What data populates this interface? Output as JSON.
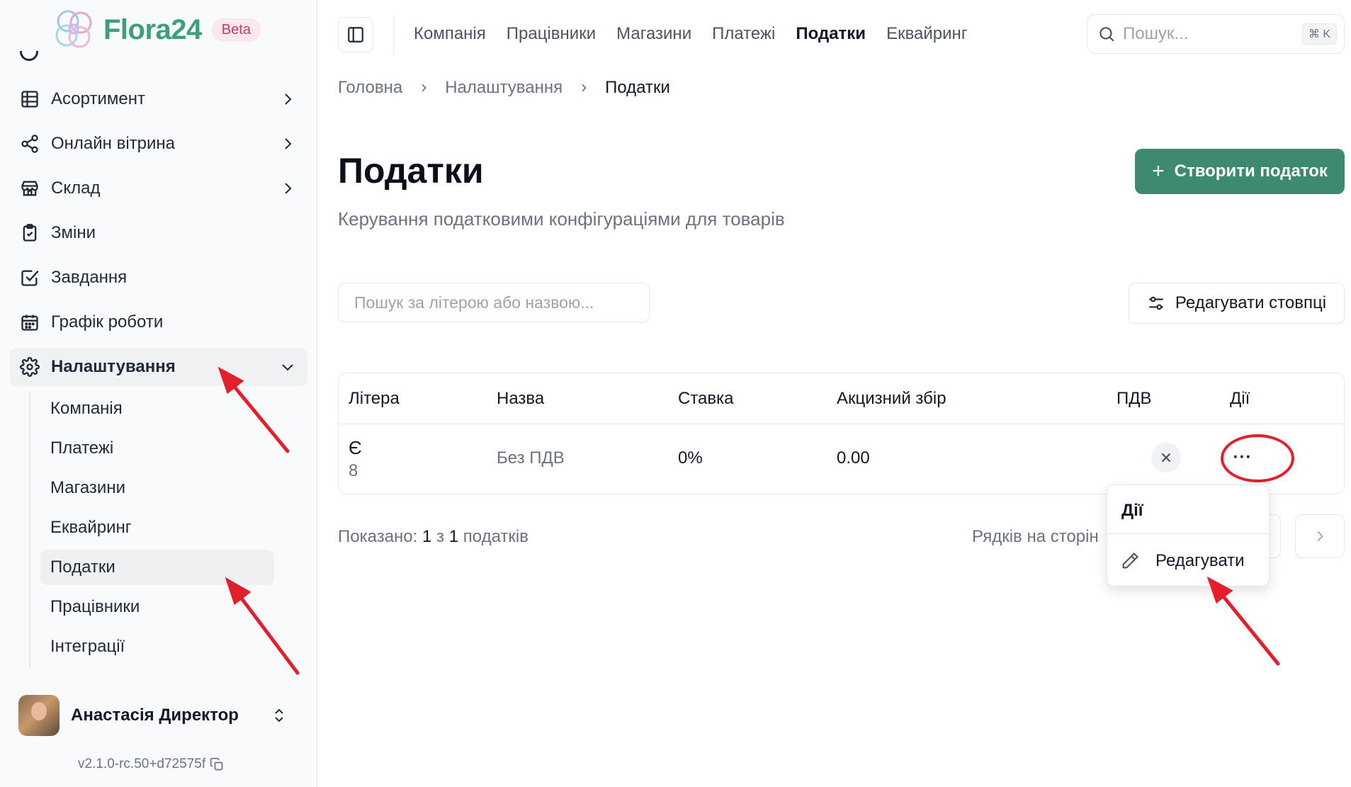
{
  "brand": {
    "name": "Flora24",
    "badge": "Beta"
  },
  "sidebar": {
    "items": [
      {
        "label": "Асортимент",
        "icon": "grid-icon",
        "has_chevron": true
      },
      {
        "label": "Онлайн вітрина",
        "icon": "share-icon",
        "has_chevron": true
      },
      {
        "label": "Склад",
        "icon": "store-icon",
        "has_chevron": true
      },
      {
        "label": "Зміни",
        "icon": "clipboard-icon",
        "has_chevron": false
      },
      {
        "label": "Завдання",
        "icon": "checkbox-icon",
        "has_chevron": false
      },
      {
        "label": "Графік роботи",
        "icon": "calendar-icon",
        "has_chevron": false
      },
      {
        "label": "Налаштування",
        "icon": "gear-icon",
        "has_chevron": true,
        "expanded": true
      }
    ],
    "subitems": [
      {
        "label": "Компанія"
      },
      {
        "label": "Платежі"
      },
      {
        "label": "Магазини"
      },
      {
        "label": "Еквайринг"
      },
      {
        "label": "Податки",
        "active": true
      },
      {
        "label": "Працівники"
      },
      {
        "label": "Інтеграції"
      }
    ],
    "user": {
      "name": "Анастасія Директор"
    },
    "version": "v2.1.0-rc.50+d72575f"
  },
  "topnav": {
    "items": [
      "Компанія",
      "Працівники",
      "Магазини",
      "Платежі",
      "Податки",
      "Еквайринг"
    ],
    "active": "Податки",
    "search_placeholder": "Пошук...",
    "search_shortcut": "⌘ K"
  },
  "breadcrumb": [
    "Головна",
    "Налаштування",
    "Податки"
  ],
  "page": {
    "title": "Податки",
    "subtitle": "Керування податковими конфігураціями для товарів",
    "create_button": "Створити податок",
    "filter_placeholder": "Пошук за літерою або назвою...",
    "columns_button": "Редагувати стовпці"
  },
  "table": {
    "headers": [
      "Літера",
      "Назва",
      "Ставка",
      "Акцизний збір",
      "ПДВ",
      "Дії"
    ],
    "rows": [
      {
        "letter": "Є",
        "letter_sub": "8",
        "name": "Без ПДВ",
        "rate": "0%",
        "excise": "0.00",
        "vat": false,
        "actions": "···"
      }
    ]
  },
  "footer": {
    "shown_prefix": "Показано:",
    "shown_from": "1",
    "shown_mid": "з",
    "shown_total": "1",
    "shown_suffix": "податків",
    "rows_label": "Рядків на сторін"
  },
  "menu": {
    "title": "Дії",
    "items": [
      {
        "label": "Редагувати",
        "icon": "pencil-icon"
      }
    ]
  },
  "colors": {
    "accent": "#3d8a6e",
    "brand_text": "#3e9e76",
    "annotation": "#e21f2b"
  }
}
